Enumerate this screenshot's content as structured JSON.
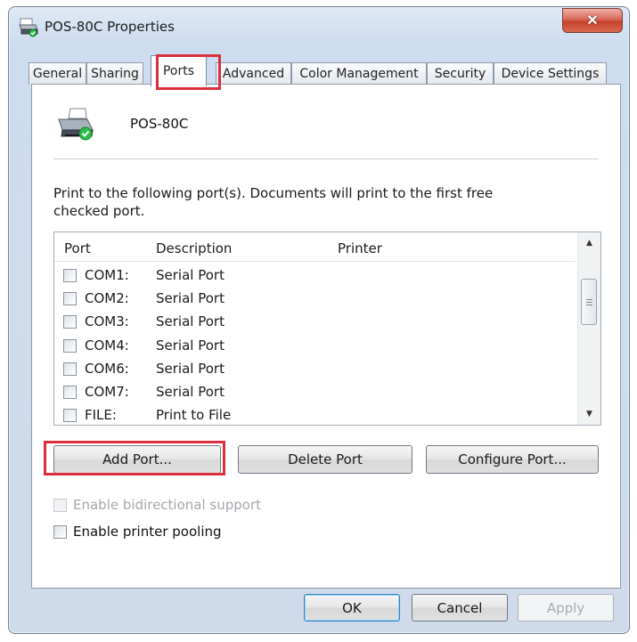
{
  "window": {
    "title": "POS-80C Properties",
    "close_label": "✕"
  },
  "tabs": [
    {
      "label": "General",
      "active": false
    },
    {
      "label": "Sharing",
      "active": false
    },
    {
      "label": "Ports",
      "active": true
    },
    {
      "label": "Advanced",
      "active": false
    },
    {
      "label": "Color Management",
      "active": false
    },
    {
      "label": "Security",
      "active": false
    },
    {
      "label": "Device Settings",
      "active": false
    }
  ],
  "printer": {
    "name": "POS-80C",
    "icon": "printer-check-icon"
  },
  "ports": {
    "instruction": "Print to the following port(s). Documents will print to the first free checked port.",
    "columns": [
      "Port",
      "Description",
      "Printer"
    ],
    "rows": [
      {
        "port": "COM1:",
        "description": "Serial Port",
        "printer": "",
        "checked": false
      },
      {
        "port": "COM2:",
        "description": "Serial Port",
        "printer": "",
        "checked": false
      },
      {
        "port": "COM3:",
        "description": "Serial Port",
        "printer": "",
        "checked": false
      },
      {
        "port": "COM4:",
        "description": "Serial Port",
        "printer": "",
        "checked": false
      },
      {
        "port": "COM6:",
        "description": "Serial Port",
        "printer": "",
        "checked": false
      },
      {
        "port": "COM7:",
        "description": "Serial Port",
        "printer": "",
        "checked": false
      },
      {
        "port": "FILE:",
        "description": "Print to File",
        "printer": "",
        "checked": false
      }
    ]
  },
  "port_buttons": {
    "add": "Add Port...",
    "delete": "Delete Port",
    "configure": "Configure Port..."
  },
  "options": {
    "bidirectional": "Enable bidirectional support",
    "pooling": "Enable printer pooling"
  },
  "footer": {
    "ok": "OK",
    "cancel": "Cancel",
    "apply": "Apply"
  },
  "colors": {
    "highlight": "#d9303c",
    "title_bar": "#cddcee",
    "close_button": "#c8412d"
  }
}
